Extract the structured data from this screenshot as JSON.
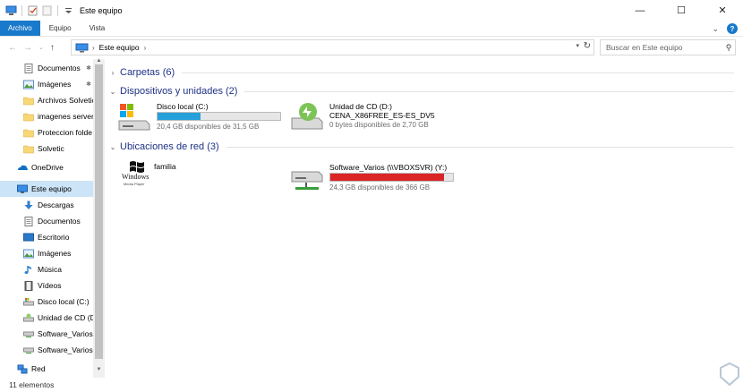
{
  "window": {
    "title": "Este equipo",
    "minimize": "—",
    "maximize": "☐",
    "close": "✕"
  },
  "ribbon": {
    "tabs": [
      "Archivo",
      "Equipo",
      "Vista"
    ],
    "expand": "⌄",
    "help": "?"
  },
  "addressbar": {
    "crumb": "Este equipo",
    "chevron": "›",
    "search_placeholder": "Buscar en Este equipo"
  },
  "navpane": {
    "items": [
      {
        "label": "Documentos",
        "icon": "documents-icon",
        "pinned": true
      },
      {
        "label": "Imágenes",
        "icon": "pictures-icon",
        "pinned": true
      },
      {
        "label": "Archivos Solvetic",
        "icon": "folder-icon",
        "pinned": false
      },
      {
        "label": "imagenes server",
        "icon": "folder-icon",
        "pinned": false
      },
      {
        "label": "Proteccion folde",
        "icon": "folder-icon",
        "pinned": false
      },
      {
        "label": "Solvetic",
        "icon": "folder-icon",
        "pinned": false
      },
      {
        "label": "OneDrive",
        "icon": "onedrive-icon",
        "pinned": false
      },
      {
        "label": "Este equipo",
        "icon": "computer-icon",
        "pinned": false,
        "selected": true
      },
      {
        "label": "Descargas",
        "icon": "downloads-icon",
        "pinned": false
      },
      {
        "label": "Documentos",
        "icon": "documents-icon",
        "pinned": false
      },
      {
        "label": "Escritorio",
        "icon": "desktop-icon",
        "pinned": false
      },
      {
        "label": "Imágenes",
        "icon": "pictures-icon",
        "pinned": false
      },
      {
        "label": "Música",
        "icon": "music-icon",
        "pinned": false
      },
      {
        "label": "Vídeos",
        "icon": "videos-icon",
        "pinned": false
      },
      {
        "label": "Disco local (C:)",
        "icon": "local-disk-icon",
        "pinned": false
      },
      {
        "label": "Unidad de CD (D:",
        "icon": "cd-drive-icon",
        "pinned": false
      },
      {
        "label": "Software_Varios",
        "icon": "network-drive-icon",
        "pinned": false
      },
      {
        "label": "Software_Varios",
        "icon": "network-drive-icon",
        "pinned": false
      },
      {
        "label": "Red",
        "icon": "network-icon",
        "pinned": false
      }
    ]
  },
  "content": {
    "groups": [
      {
        "label": "Carpetas (6)"
      },
      {
        "label": "Dispositivos y unidades (2)"
      },
      {
        "label": "Ubicaciones de red (3)"
      }
    ],
    "drives": [
      {
        "name": "Disco local (C:)",
        "free": "20,4 GB disponibles de 31,5 GB",
        "used_fraction": 0.35,
        "icon": "local-disk-icon"
      },
      {
        "name": "Unidad de CD (D:)",
        "sub": "CENA_X86FREE_ES-ES_DV5",
        "free": "0 bytes disponibles de 2,70 GB",
        "icon": "cd-drive-icon"
      },
      {
        "name": "familia",
        "icon": "windows-media-player-icon",
        "logo_text": "Windows",
        "logo_sub": "Media Player"
      },
      {
        "name": "Software_Varios (\\\\VBOXSVR) (Y:)",
        "free": "24,3 GB disponibles de 366 GB",
        "used_fraction": 0.93,
        "icon": "network-drive-icon"
      }
    ]
  },
  "status": {
    "count": "11 elementos"
  },
  "colors": {
    "accent": "#1979ca",
    "group_label": "#1e3287",
    "bar_normal": "#26a0da",
    "bar_full": "#da2626",
    "selection": "#cce4f7"
  }
}
